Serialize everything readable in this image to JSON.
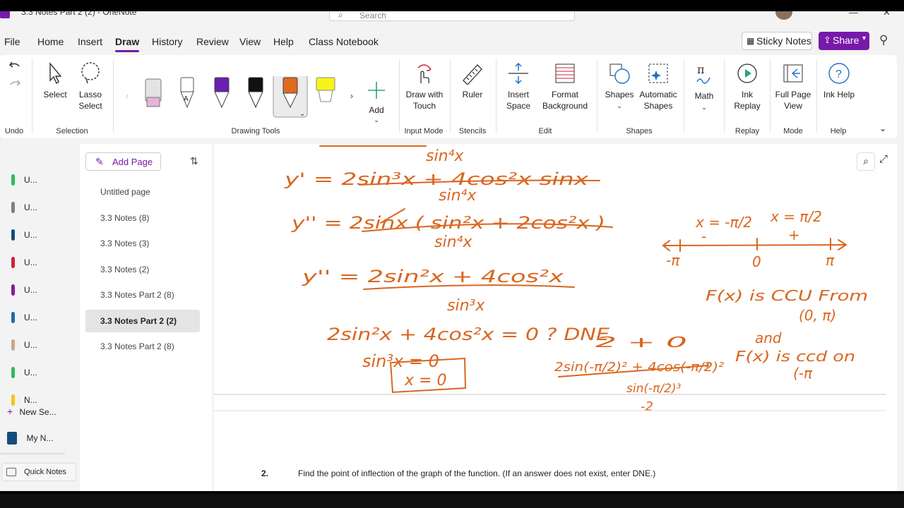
{
  "window": {
    "title": "3.3 Notes Part 2 (2) - OneNote",
    "search_placeholder": "Search",
    "min": "—",
    "close": "✕"
  },
  "menu": {
    "items": [
      "File",
      "Home",
      "Insert",
      "Draw",
      "History",
      "Review",
      "View",
      "Help",
      "Class Notebook"
    ],
    "active": "Draw",
    "sticky_notes": "Sticky Notes",
    "share": "Share"
  },
  "ribbon": {
    "undo": {
      "label": "Undo"
    },
    "selection": {
      "select": "Select",
      "lasso": "Lasso Select",
      "group": "Selection"
    },
    "drawing_tools": {
      "group": "Drawing Tools",
      "pen_colors": [
        "#e5b3d9",
        "#ffffff",
        "#6a1fb0",
        "#111111",
        "#e06a1e",
        "#f7f31a"
      ]
    },
    "add": "Add",
    "input_mode": {
      "draw_touch": "Draw with Touch",
      "group": "Input Mode"
    },
    "stencils": {
      "ruler": "Ruler",
      "group": "Stencils"
    },
    "edit": {
      "insert_space": "Insert Space",
      "format_bg": "Format Background",
      "group": "Edit"
    },
    "shapes": {
      "shapes": "Shapes",
      "auto": "Automatic Shapes",
      "group": "Shapes"
    },
    "math": "Math",
    "replay": {
      "ink_replay": "Ink Replay",
      "group": "Replay"
    },
    "mode": {
      "full_page": "Full Page View",
      "group": "Mode"
    },
    "help": {
      "ink_help": "Ink Help",
      "group": "Help"
    }
  },
  "sections": [
    {
      "label": "U...",
      "color": "#2dbd56"
    },
    {
      "label": "U...",
      "color": "#7b7f86"
    },
    {
      "label": "U...",
      "color": "#154c7a"
    },
    {
      "label": "U...",
      "color": "#d0233a"
    },
    {
      "label": "U...",
      "color": "#8b1a9a"
    },
    {
      "label": "U...",
      "color": "#1c6dad"
    },
    {
      "label": "U...",
      "color": "#c8a890"
    },
    {
      "label": "U...",
      "color": "#2dbd56"
    },
    {
      "label": "N...",
      "color": "#f2c811"
    }
  ],
  "new_section": "New Se...",
  "notebook": "My N...",
  "quick_notes": "Quick Notes",
  "pages": {
    "add_page": "Add Page",
    "items": [
      "Untitled page",
      "3.3 Notes (8)",
      "3.3 Notes (3)",
      "3.3 Notes (2)",
      "3.3 Notes Part 2 (8)",
      "3.3 Notes Part 2 (2)",
      "3.3 Notes Part 2 (8)"
    ],
    "selected_index": 5
  },
  "ink": {
    "line1": "sin⁴x",
    "line2": "y' = 2sin³x + 4cos²x sinx",
    "line2_den": "sin⁴x",
    "line3": "y'' = 2sinx ( sin²x + 2cos²x )",
    "line3_den": "sin⁴x",
    "line4": "y'' = 2sin²x + 4cos²x",
    "line4_den": "sin³x",
    "line5": "2sin²x + 4cos²x = 0 ? DNE",
    "line6": "sin³x = 0",
    "line7": "x = 0",
    "nl_left": "x = -π/2",
    "nl_right": "x = π/2",
    "nl_ticks": [
      "-π",
      "0",
      "π"
    ],
    "signs": [
      "-",
      "+"
    ],
    "concl1": "F(x) is CCU From",
    "concl2": "(0, π)",
    "concl3": "and",
    "concl4": "F(x) is ccd on",
    "concl5": "(-π",
    "test_top": "2 + 0",
    "test_num": "2sin(-π/2)² + 4cos(-π/2)²",
    "test_den": "sin(-π/2)³",
    "test_res": "-2",
    "ink_color": "#d9661f"
  },
  "question": {
    "number": "2.",
    "text": "Find the point of inflection of the graph of the function. (If an answer does not exist, enter DNE.)"
  }
}
